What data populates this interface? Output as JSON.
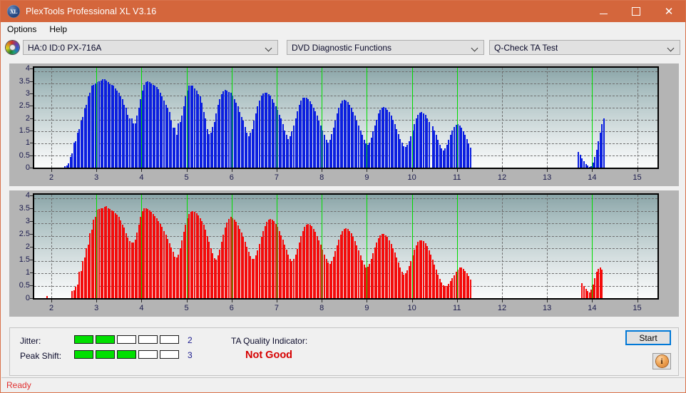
{
  "window": {
    "title": "PlexTools Professional XL V3.16",
    "icon": "XL",
    "controls": {
      "minimize": "–",
      "maximize": "□",
      "close": "✕"
    }
  },
  "menu": {
    "items": [
      "Options",
      "Help"
    ]
  },
  "toolbar": {
    "drive_icon": "disc-icon",
    "drive": "HA:0 ID:0  PX-716A",
    "function": "DVD Diagnostic Functions",
    "test": "Q-Check TA Test"
  },
  "info": {
    "jitter_label": "Jitter:",
    "jitter_value": "2",
    "jitter_filled": 2,
    "jitter_total": 5,
    "peak_shift_label": "Peak Shift:",
    "peak_shift_value": "3",
    "peak_shift_filled": 3,
    "peak_shift_total": 5,
    "ta_label": "TA Quality Indicator:",
    "ta_value": "Not Good",
    "ta_color": "#d60000",
    "start_label": "Start",
    "info_glyph": "i"
  },
  "status": {
    "text": "Ready",
    "color": "#e03030"
  },
  "chart_data": [
    {
      "id": "jitter-chart",
      "type": "bar",
      "title": "",
      "xlabel": "",
      "ylabel": "",
      "color": "#0b1fe0",
      "xlim": [
        1.62,
        15.45
      ],
      "ylim": [
        0,
        4.15
      ],
      "xticks": [
        2,
        3,
        4,
        5,
        6,
        7,
        8,
        9,
        10,
        11,
        12,
        13,
        14,
        15
      ],
      "yticks": [
        0,
        0.5,
        1,
        1.5,
        2,
        2.5,
        3,
        3.5,
        4
      ],
      "ytick_labels": [
        "0",
        "0.5",
        "1",
        "1.5",
        "2",
        "2.5",
        "3",
        "3.5",
        "4"
      ],
      "grid": true,
      "markers": [
        3,
        4,
        5,
        6,
        7,
        8,
        9,
        10,
        11,
        14
      ],
      "x": [
        2.3,
        2.34,
        2.38,
        2.42,
        2.46,
        2.5,
        2.54,
        2.58,
        2.62,
        2.66,
        2.7,
        2.74,
        2.78,
        2.82,
        2.86,
        2.9,
        2.94,
        2.98,
        3.02,
        3.06,
        3.1,
        3.14,
        3.18,
        3.22,
        3.26,
        3.3,
        3.34,
        3.38,
        3.42,
        3.46,
        3.5,
        3.54,
        3.58,
        3.62,
        3.66,
        3.7,
        3.74,
        3.78,
        3.82,
        3.86,
        3.9,
        3.94,
        3.98,
        4.02,
        4.06,
        4.1,
        4.14,
        4.18,
        4.22,
        4.26,
        4.3,
        4.34,
        4.38,
        4.42,
        4.46,
        4.5,
        4.54,
        4.58,
        4.62,
        4.66,
        4.7,
        4.74,
        4.78,
        4.82,
        4.86,
        4.9,
        4.94,
        4.98,
        5.02,
        5.06,
        5.1,
        5.14,
        5.18,
        5.22,
        5.26,
        5.3,
        5.34,
        5.38,
        5.42,
        5.46,
        5.5,
        5.54,
        5.58,
        5.62,
        5.66,
        5.7,
        5.74,
        5.78,
        5.82,
        5.86,
        5.9,
        5.94,
        5.98,
        6.02,
        6.06,
        6.1,
        6.14,
        6.18,
        6.22,
        6.26,
        6.3,
        6.34,
        6.38,
        6.42,
        6.46,
        6.5,
        6.54,
        6.58,
        6.62,
        6.66,
        6.7,
        6.74,
        6.78,
        6.82,
        6.86,
        6.9,
        6.94,
        6.98,
        7.02,
        7.06,
        7.1,
        7.14,
        7.18,
        7.22,
        7.26,
        7.3,
        7.34,
        7.38,
        7.42,
        7.46,
        7.5,
        7.54,
        7.58,
        7.62,
        7.66,
        7.7,
        7.74,
        7.78,
        7.82,
        7.86,
        7.9,
        7.94,
        7.98,
        8.02,
        8.06,
        8.1,
        8.14,
        8.18,
        8.22,
        8.26,
        8.3,
        8.34,
        8.38,
        8.42,
        8.46,
        8.5,
        8.54,
        8.58,
        8.62,
        8.66,
        8.7,
        8.74,
        8.78,
        8.82,
        8.86,
        8.9,
        8.94,
        8.98,
        9.02,
        9.06,
        9.1,
        9.14,
        9.18,
        9.22,
        9.26,
        9.3,
        9.34,
        9.38,
        9.42,
        9.46,
        9.5,
        9.54,
        9.58,
        9.62,
        9.66,
        9.7,
        9.74,
        9.78,
        9.82,
        9.86,
        9.9,
        9.94,
        9.98,
        10.02,
        10.06,
        10.1,
        10.14,
        10.18,
        10.22,
        10.26,
        10.3,
        10.34,
        10.38,
        10.46,
        10.5,
        10.54,
        10.58,
        10.62,
        10.66,
        10.7,
        10.74,
        10.78,
        10.82,
        10.86,
        10.9,
        10.94,
        10.98,
        11.02,
        11.06,
        11.1,
        11.14,
        11.18,
        11.22,
        11.26,
        11.3,
        13.7,
        13.74,
        13.78,
        13.82,
        13.86,
        13.9,
        13.94,
        13.98,
        14.02,
        14.06,
        14.1,
        14.14,
        14.18,
        14.22,
        14.26
      ],
      "values": [
        0.07,
        0.1,
        0.18,
        0.45,
        0.6,
        1.05,
        1.1,
        1.45,
        1.6,
        1.95,
        2.1,
        2.45,
        2.6,
        2.95,
        3.1,
        3.4,
        3.45,
        3.5,
        3.55,
        3.6,
        3.62,
        3.68,
        3.68,
        3.62,
        3.55,
        3.48,
        3.45,
        3.4,
        3.3,
        3.2,
        3.1,
        2.95,
        2.85,
        2.6,
        2.5,
        2.2,
        2.05,
        2.05,
        1.85,
        1.85,
        2.15,
        2.5,
        2.85,
        3.2,
        3.45,
        3.55,
        3.58,
        3.55,
        3.5,
        3.45,
        3.4,
        3.35,
        3.25,
        3.12,
        2.95,
        2.8,
        2.6,
        2.5,
        2.3,
        1.95,
        1.65,
        1.65,
        1.35,
        1.85,
        1.9,
        2.15,
        2.55,
        2.95,
        3.2,
        3.4,
        3.42,
        3.42,
        3.3,
        3.2,
        3.05,
        2.95,
        2.7,
        2.3,
        2.05,
        1.6,
        1.4,
        1.45,
        1.7,
        1.9,
        2.25,
        2.6,
        2.85,
        3.05,
        3.18,
        3.22,
        3.2,
        3.15,
        3.1,
        3.0,
        2.85,
        2.7,
        2.55,
        2.3,
        2.1,
        1.95,
        1.7,
        1.45,
        1.3,
        1.45,
        1.6,
        1.95,
        2.25,
        2.55,
        2.8,
        3.0,
        3.08,
        3.12,
        3.1,
        3.05,
        3.0,
        2.85,
        2.7,
        2.55,
        2.4,
        2.2,
        2.05,
        1.8,
        1.55,
        1.35,
        1.2,
        1.3,
        1.5,
        1.75,
        2.05,
        2.35,
        2.6,
        2.78,
        2.9,
        2.92,
        2.9,
        2.85,
        2.75,
        2.65,
        2.5,
        2.35,
        2.15,
        1.95,
        1.75,
        1.55,
        1.35,
        1.15,
        1.05,
        1.15,
        1.4,
        1.65,
        1.95,
        2.25,
        2.5,
        2.68,
        2.78,
        2.82,
        2.8,
        2.72,
        2.62,
        2.48,
        2.32,
        2.15,
        1.95,
        1.75,
        1.55,
        1.35,
        1.15,
        1.0,
        0.95,
        1.05,
        1.25,
        1.5,
        1.75,
        2.0,
        2.25,
        2.4,
        2.5,
        2.52,
        2.48,
        2.4,
        2.3,
        2.15,
        2.0,
        1.8,
        1.6,
        1.4,
        1.2,
        1.05,
        0.9,
        0.85,
        0.95,
        1.1,
        1.3,
        1.55,
        1.8,
        2.05,
        2.2,
        2.28,
        2.3,
        2.25,
        2.18,
        2.05,
        1.9,
        1.72,
        1.55,
        1.35,
        1.15,
        0.95,
        0.8,
        0.72,
        0.8,
        0.95,
        1.15,
        1.35,
        1.55,
        1.7,
        1.78,
        1.8,
        1.75,
        1.65,
        1.52,
        1.35,
        1.18,
        1.0,
        0.82,
        0.65,
        0.52,
        0.4,
        0.28,
        0.15,
        0.08,
        0.04,
        0.06,
        0.2,
        0.45,
        0.75,
        1.1,
        1.45,
        1.8,
        2.05,
        2.15,
        2.12,
        2.05,
        1.8,
        1.45,
        1.05,
        0.6,
        0.2,
        0.06
      ]
    },
    {
      "id": "peak-shift-chart",
      "type": "bar",
      "title": "",
      "xlabel": "",
      "ylabel": "",
      "color": "#f40b0b",
      "xlim": [
        1.62,
        15.45
      ],
      "ylim": [
        0,
        4.15
      ],
      "xticks": [
        2,
        3,
        4,
        5,
        6,
        7,
        8,
        9,
        10,
        11,
        12,
        13,
        14,
        15
      ],
      "yticks": [
        0,
        0.5,
        1,
        1.5,
        2,
        2.5,
        3,
        3.5,
        4
      ],
      "ytick_labels": [
        "0",
        "0.5",
        "1",
        "1.5",
        "2",
        "2.5",
        "3",
        "3.5",
        "4"
      ],
      "grid": true,
      "markers": [
        3,
        4,
        5,
        6,
        7,
        8,
        9,
        10,
        11,
        14
      ],
      "x": [
        1.9,
        2.46,
        2.5,
        2.54,
        2.58,
        2.62,
        2.66,
        2.7,
        2.74,
        2.78,
        2.82,
        2.86,
        2.9,
        2.94,
        2.98,
        3.02,
        3.06,
        3.1,
        3.14,
        3.18,
        3.22,
        3.26,
        3.3,
        3.34,
        3.38,
        3.42,
        3.46,
        3.5,
        3.54,
        3.58,
        3.62,
        3.66,
        3.7,
        3.74,
        3.78,
        3.82,
        3.86,
        3.9,
        3.94,
        3.98,
        4.02,
        4.06,
        4.1,
        4.14,
        4.18,
        4.22,
        4.26,
        4.3,
        4.34,
        4.38,
        4.42,
        4.46,
        4.5,
        4.54,
        4.58,
        4.62,
        4.66,
        4.7,
        4.74,
        4.78,
        4.82,
        4.86,
        4.9,
        4.94,
        4.98,
        5.02,
        5.06,
        5.1,
        5.14,
        5.18,
        5.22,
        5.26,
        5.3,
        5.34,
        5.38,
        5.42,
        5.46,
        5.5,
        5.54,
        5.58,
        5.62,
        5.66,
        5.7,
        5.74,
        5.78,
        5.82,
        5.86,
        5.9,
        5.94,
        5.98,
        6.02,
        6.06,
        6.1,
        6.14,
        6.18,
        6.22,
        6.26,
        6.3,
        6.34,
        6.38,
        6.42,
        6.46,
        6.5,
        6.54,
        6.58,
        6.62,
        6.66,
        6.7,
        6.74,
        6.78,
        6.82,
        6.86,
        6.9,
        6.94,
        6.98,
        7.02,
        7.06,
        7.1,
        7.14,
        7.18,
        7.22,
        7.26,
        7.3,
        7.34,
        7.38,
        7.42,
        7.46,
        7.5,
        7.54,
        7.58,
        7.62,
        7.66,
        7.7,
        7.74,
        7.78,
        7.82,
        7.86,
        7.9,
        7.94,
        7.98,
        8.02,
        8.06,
        8.1,
        8.14,
        8.18,
        8.22,
        8.26,
        8.3,
        8.34,
        8.38,
        8.42,
        8.46,
        8.5,
        8.54,
        8.58,
        8.62,
        8.66,
        8.7,
        8.74,
        8.78,
        8.82,
        8.86,
        8.9,
        8.94,
        8.98,
        9.02,
        9.06,
        9.1,
        9.14,
        9.18,
        9.22,
        9.26,
        9.3,
        9.34,
        9.38,
        9.42,
        9.46,
        9.5,
        9.54,
        9.58,
        9.62,
        9.66,
        9.7,
        9.74,
        9.78,
        9.82,
        9.86,
        9.9,
        9.94,
        9.98,
        10.02,
        10.06,
        10.1,
        10.14,
        10.18,
        10.22,
        10.26,
        10.3,
        10.34,
        10.38,
        10.42,
        10.46,
        10.5,
        10.54,
        10.58,
        10.62,
        10.66,
        10.7,
        10.74,
        10.78,
        10.82,
        10.86,
        10.9,
        10.94,
        10.98,
        11.02,
        11.06,
        11.1,
        11.14,
        11.18,
        11.22,
        11.26,
        11.3,
        13.78,
        13.82,
        13.86,
        13.9,
        13.94,
        13.98,
        14.02,
        14.06,
        14.1,
        14.14,
        14.18,
        14.22
      ],
      "values": [
        0.1,
        0.28,
        0.32,
        0.45,
        0.55,
        1.05,
        1.1,
        1.5,
        1.62,
        2.0,
        2.15,
        2.6,
        2.75,
        3.15,
        3.25,
        3.55,
        3.58,
        3.6,
        3.62,
        3.65,
        3.68,
        3.62,
        3.58,
        3.52,
        3.48,
        3.42,
        3.35,
        3.25,
        3.12,
        2.95,
        2.82,
        2.6,
        2.42,
        2.3,
        2.22,
        2.22,
        2.35,
        2.62,
        2.95,
        3.25,
        3.5,
        3.6,
        3.62,
        3.58,
        3.52,
        3.45,
        3.38,
        3.3,
        3.2,
        3.1,
        2.98,
        2.85,
        2.7,
        2.55,
        2.38,
        2.2,
        2.02,
        1.85,
        1.65,
        1.62,
        1.75,
        2.0,
        2.32,
        2.65,
        2.95,
        3.22,
        3.38,
        3.45,
        3.48,
        3.45,
        3.4,
        3.32,
        3.22,
        3.1,
        2.95,
        2.75,
        2.5,
        2.25,
        2.0,
        1.8,
        1.6,
        1.55,
        1.72,
        1.95,
        2.25,
        2.55,
        2.82,
        3.02,
        3.18,
        3.25,
        3.22,
        3.15,
        3.05,
        2.92,
        2.78,
        2.62,
        2.45,
        2.25,
        2.05,
        1.85,
        1.7,
        1.58,
        1.58,
        1.72,
        1.92,
        2.18,
        2.45,
        2.7,
        2.9,
        3.05,
        3.15,
        3.18,
        3.15,
        3.08,
        2.98,
        2.85,
        2.7,
        2.52,
        2.35,
        2.15,
        1.95,
        1.75,
        1.58,
        1.5,
        1.58,
        1.75,
        1.98,
        2.22,
        2.48,
        2.7,
        2.85,
        2.95,
        2.98,
        2.95,
        2.88,
        2.78,
        2.65,
        2.5,
        2.32,
        2.15,
        1.95,
        1.75,
        1.58,
        1.42,
        1.38,
        1.48,
        1.65,
        1.88,
        2.12,
        2.35,
        2.55,
        2.7,
        2.78,
        2.8,
        2.78,
        2.7,
        2.6,
        2.45,
        2.3,
        2.12,
        1.92,
        1.72,
        1.52,
        1.35,
        1.22,
        1.25,
        1.38,
        1.58,
        1.8,
        2.02,
        2.22,
        2.4,
        2.52,
        2.58,
        2.58,
        2.52,
        2.45,
        2.32,
        2.18,
        2.0,
        1.82,
        1.62,
        1.42,
        1.22,
        1.05,
        0.95,
        1.0,
        1.12,
        1.3,
        1.5,
        1.72,
        1.95,
        2.12,
        2.25,
        2.32,
        2.32,
        2.28,
        2.2,
        2.08,
        1.92,
        1.75,
        1.55,
        1.35,
        1.15,
        0.95,
        0.78,
        0.62,
        0.52,
        0.48,
        0.5,
        0.58,
        0.68,
        0.8,
        0.92,
        1.05,
        1.15,
        1.22,
        1.22,
        1.18,
        1.1,
        1.0,
        0.88,
        0.75,
        0.6,
        0.48,
        0.38,
        0.3,
        0.22,
        0.35,
        0.55,
        0.8,
        1.05,
        1.18,
        1.22,
        1.15,
        0.98,
        0.75,
        0.5,
        0.28,
        0.12
      ]
    }
  ]
}
